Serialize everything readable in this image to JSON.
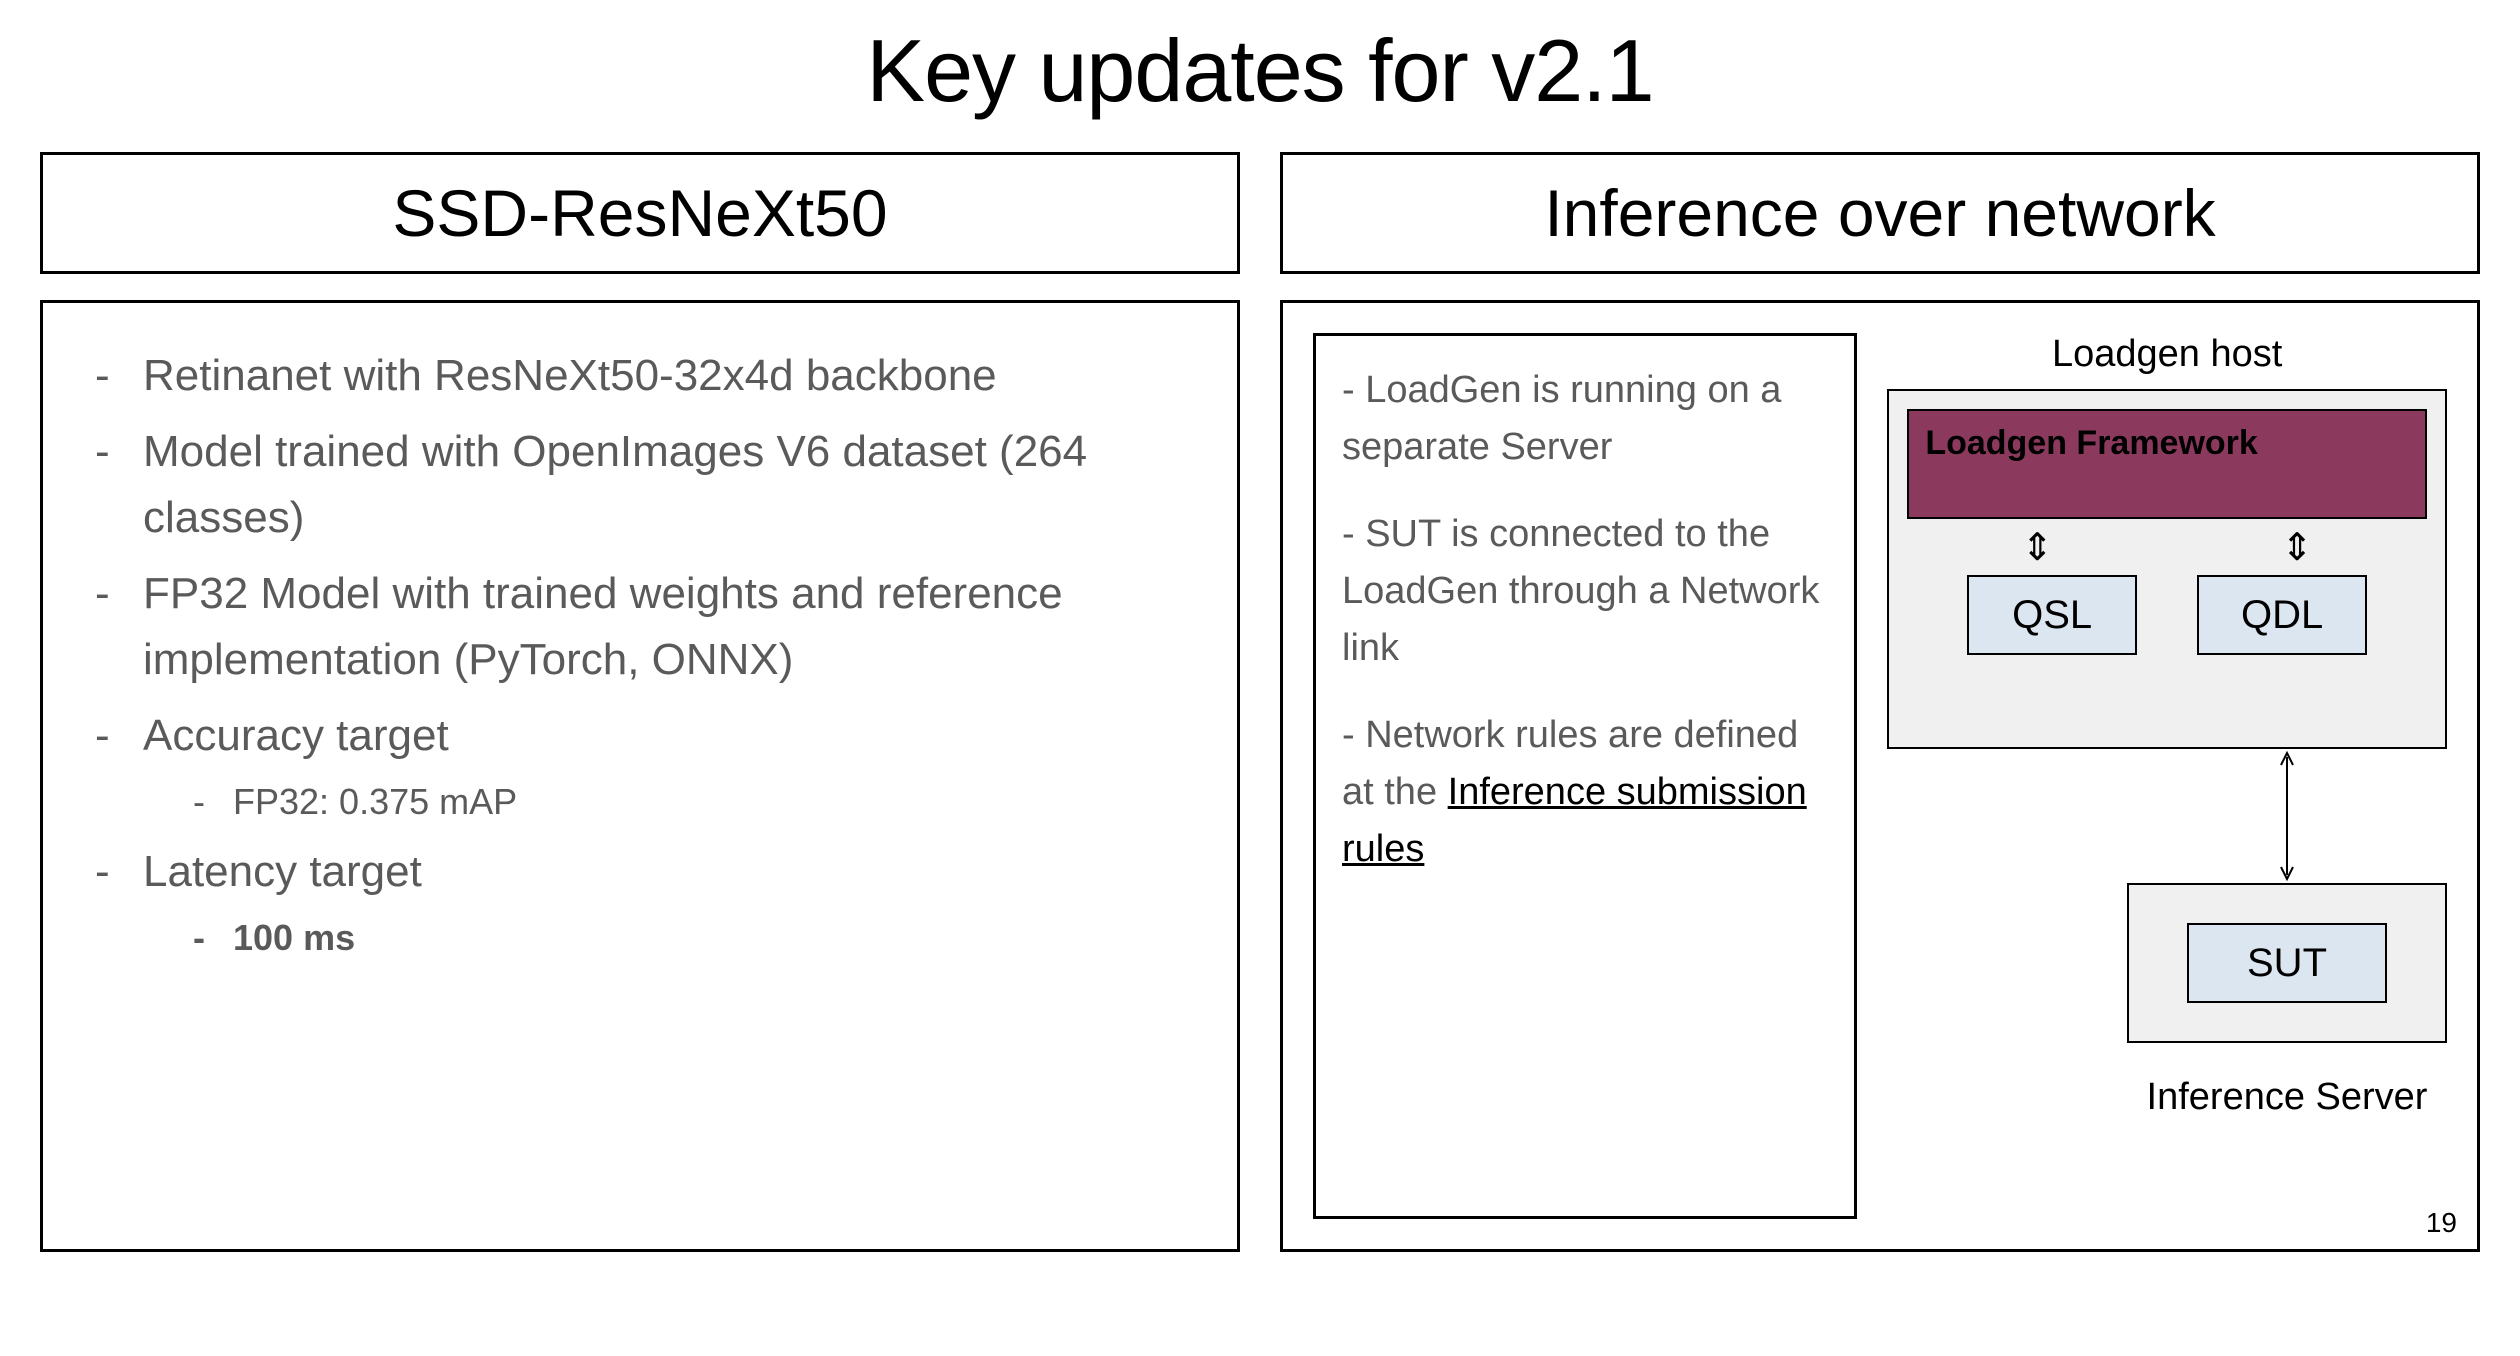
{
  "title": "Key updates for v2.1",
  "left": {
    "header": "SSD-ResNeXt50",
    "items": [
      "Retinanet with ResNeXt50-32x4d backbone",
      "Model trained with OpenImages V6 dataset (264 classes)",
      "FP32 Model with trained weights and reference implementation (PyTorch, ONNX)",
      "Accuracy target",
      "Latency target"
    ],
    "accuracy_sub": "FP32: 0.375 mAP",
    "latency_sub": "100 ms"
  },
  "right": {
    "header": "Inference over network",
    "para1": "- LoadGen is running on a separate Server",
    "para2": "- SUT is connected to the LoadGen through a Network link",
    "para3_prefix": "- Network rules are defined at the ",
    "para3_link": "Inference submission rules",
    "diagram": {
      "host_label": "Loadgen host",
      "framework": "Loadgen Framework",
      "qsl": "QSL",
      "qdl": "QDL",
      "sut": "SUT",
      "server_label": "Inference Server"
    }
  },
  "page": "19"
}
